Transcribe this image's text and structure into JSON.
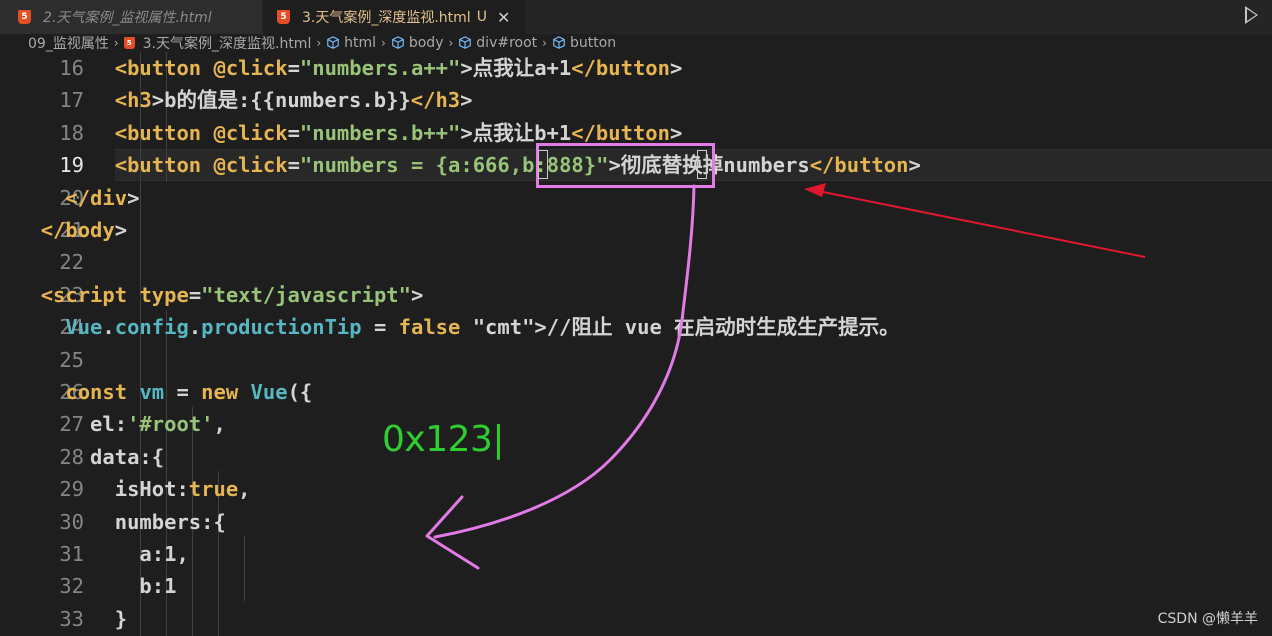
{
  "tabs": [
    {
      "label": "2.天气案例_监视属性.html",
      "state": "inactive"
    },
    {
      "label": "3.天气案例_深度监视.html",
      "state": "active",
      "badge": "U"
    }
  ],
  "breadcrumb": {
    "folder": "09_监视属性",
    "file": "3.天气案例_深度监视.html",
    "nodes": [
      "html",
      "body",
      "div#root",
      "button"
    ]
  },
  "editor": {
    "current_line": 19,
    "lines": [
      {
        "num": "16",
        "code": "        <button @click=\"numbers.a++\">点我让a+1</button>"
      },
      {
        "num": "17",
        "code": "        <h3>b的值是:{{numbers.b}}</h3>"
      },
      {
        "num": "18",
        "code": "        <button @click=\"numbers.b++\">点我让b+1</button>"
      },
      {
        "num": "19",
        "code": "        <button @click=\"numbers = {a:666,b:888}\">彻底替换掉numbers</button>"
      },
      {
        "num": "20",
        "code": "    </div>"
      },
      {
        "num": "21",
        "code": "  </body>"
      },
      {
        "num": "22",
        "code": ""
      },
      {
        "num": "23",
        "code": "  <script type=\"text/javascript\">"
      },
      {
        "num": "24",
        "code": "    Vue.config.productionTip = false //阻止 vue 在启动时生成生产提示。"
      },
      {
        "num": "25",
        "code": ""
      },
      {
        "num": "26",
        "code": "    const vm = new Vue({"
      },
      {
        "num": "27",
        "code": "      el:'#root',"
      },
      {
        "num": "28",
        "code": "      data:{"
      },
      {
        "num": "29",
        "code": "        isHot:true,"
      },
      {
        "num": "30",
        "code": "        numbers:{"
      },
      {
        "num": "31",
        "code": "          a:1,"
      },
      {
        "num": "32",
        "code": "          b:1"
      },
      {
        "num": "33",
        "code": "        }"
      }
    ]
  },
  "annotations": {
    "handwritten_text": "0x123|"
  },
  "watermark": "CSDN @懒羊羊",
  "colors": {
    "highlight_box": "#e27be6",
    "red_arrow": "#e0182f",
    "pink_arrow": "#e27be6",
    "handwriting": "#2fce2f"
  },
  "icons": {
    "html_file": "html5-icon",
    "element_node": "cube-icon",
    "run": "play-icon"
  }
}
